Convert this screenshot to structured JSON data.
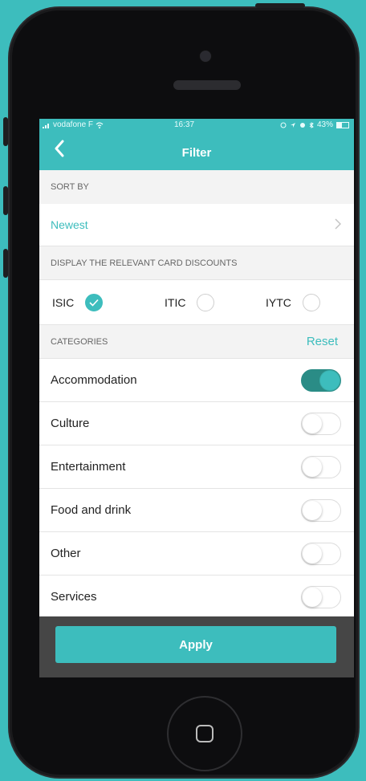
{
  "status_bar": {
    "carrier": "vodafone F",
    "time": "16:37",
    "battery": "43%",
    "battery_level": 0.43
  },
  "nav": {
    "title": "Filter",
    "back_icon": "chevron-left-icon"
  },
  "sort": {
    "header": "SORT BY",
    "value": "Newest"
  },
  "display": {
    "header": "DISPLAY THE RELEVANT CARD DISCOUNTS",
    "cards": [
      {
        "label": "ISIC",
        "checked": true
      },
      {
        "label": "ITIC",
        "checked": false
      },
      {
        "label": "IYTC",
        "checked": false
      }
    ]
  },
  "categories": {
    "header": "CATEGORIES",
    "reset_label": "Reset",
    "items": [
      {
        "label": "Accommodation",
        "on": true
      },
      {
        "label": "Culture",
        "on": false
      },
      {
        "label": "Entertainment",
        "on": false
      },
      {
        "label": "Food and drink",
        "on": false
      },
      {
        "label": "Other",
        "on": false
      },
      {
        "label": "Services",
        "on": false
      }
    ]
  },
  "apply": {
    "label": "Apply"
  },
  "colors": {
    "accent": "#3dbdbd",
    "background": "#3dbdbd",
    "toggle_on_track": "#2a8c86",
    "apply_bar": "#464646"
  }
}
